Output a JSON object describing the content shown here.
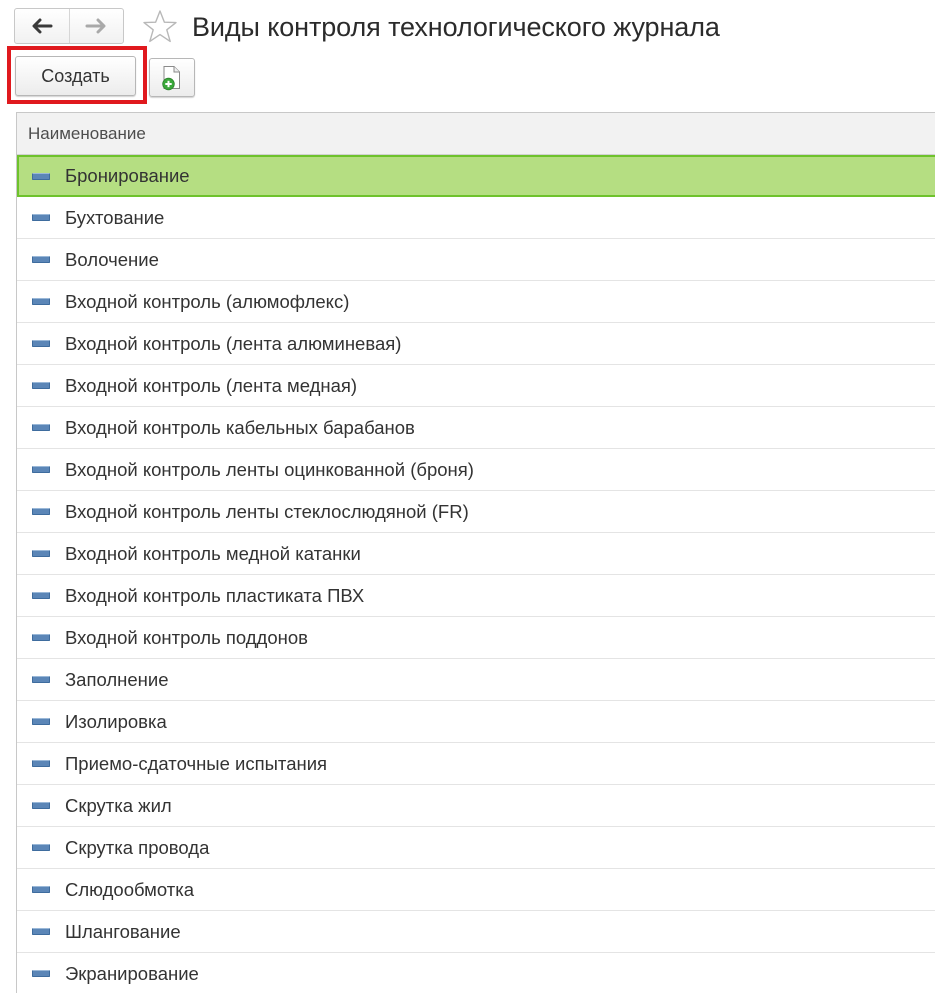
{
  "window": {
    "title": "Виды контроля технологического журнала"
  },
  "navigation": {
    "back_icon": "arrow-left-icon",
    "forward_icon": "arrow-right-icon",
    "favorite_icon": "star-icon"
  },
  "toolbar": {
    "create_label": "Создать",
    "copy_icon": "document-add-icon",
    "highlight_color": "#e0191e"
  },
  "table": {
    "column_header": "Наименование",
    "row_icon": "catalog-item-icon",
    "selected_color": "#b5de82",
    "rows": [
      "Бронирование",
      "Бухтование",
      "Волочение",
      "Входной контроль (алюмофлекс)",
      "Входной контроль (лента алюминевая)",
      "Входной контроль (лента медная)",
      "Входной контроль кабельных барабанов",
      "Входной контроль ленты оцинкованной (броня)",
      "Входной контроль ленты стеклослюдяной (FR)",
      "Входной контроль медной катанки",
      "Входной контроль пластиката ПВХ",
      "Входной контроль поддонов",
      "Заполнение",
      "Изолировка",
      "Приемо-сдаточные испытания",
      "Скрутка жил",
      "Скрутка провода",
      "Слюдообмотка",
      "Шлангование",
      "Экранирование"
    ],
    "selected_index": 0
  }
}
